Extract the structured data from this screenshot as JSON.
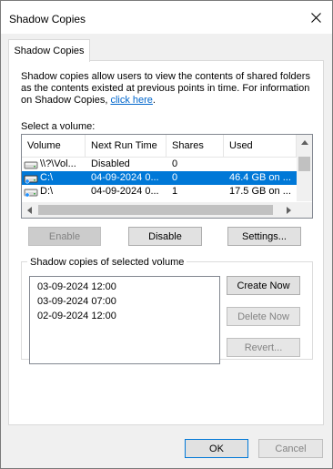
{
  "window": {
    "title": "Shadow Copies"
  },
  "tabs": [
    {
      "label": "Shadow Copies"
    }
  ],
  "description": {
    "text": "Shadow copies allow users to view the contents of shared folders as the contents existed at previous points in time. For information on Shadow Copies, ",
    "link": "click here",
    "suffix": "."
  },
  "volume_section": {
    "label": "Select a volume:",
    "columns": [
      "Volume",
      "Next Run Time",
      "Shares",
      "Used"
    ],
    "rows": [
      {
        "volume": "\\\\?\\Vol...",
        "next_run": "Disabled",
        "shares": "0",
        "used": "",
        "icon": "drive-icon",
        "selected": false
      },
      {
        "volume": "C:\\",
        "next_run": "04-09-2024 0...",
        "shares": "0",
        "used": "46.4 GB on ...",
        "icon": "drive-icon",
        "selected": true
      },
      {
        "volume": "D:\\",
        "next_run": "04-09-2024 0...",
        "shares": "1",
        "used": "17.5 GB on ...",
        "icon": "drive-icon",
        "selected": false
      }
    ]
  },
  "volume_buttons": {
    "enable": "Enable",
    "disable": "Disable",
    "settings": "Settings..."
  },
  "copies_section": {
    "label": "Shadow copies of selected volume",
    "items": [
      "03-09-2024 12:00",
      "03-09-2024 07:00",
      "02-09-2024 12:00"
    ],
    "create_now": "Create Now",
    "delete_now": "Delete Now",
    "revert": "Revert..."
  },
  "dialog_buttons": {
    "ok": "OK",
    "cancel": "Cancel"
  },
  "colors": {
    "selection": "#0078d7",
    "link": "#0066cc",
    "default_button_border": "#0078d7"
  }
}
